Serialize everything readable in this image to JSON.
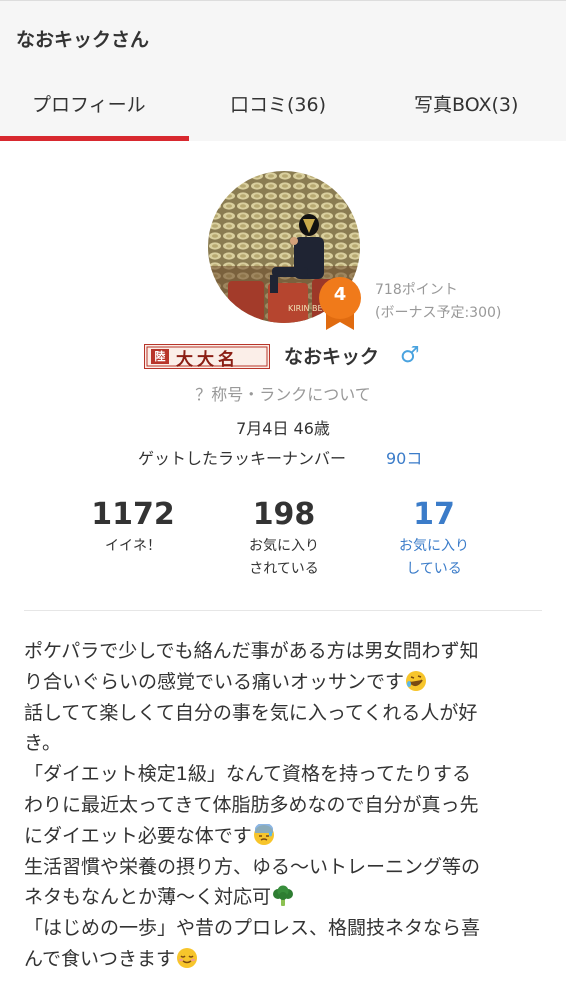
{
  "header": {
    "title": "なおキックさん"
  },
  "tabs": [
    {
      "label": "プロフィール",
      "active": true
    },
    {
      "label": "口コミ(36)",
      "active": false
    },
    {
      "label": "写真BOX(3)",
      "active": false
    }
  ],
  "profile": {
    "rank": "4",
    "points": "718ポイント",
    "bonus": "(ボーナス予定:300)",
    "title_badge": "大大名",
    "username": "なおキック",
    "gender_symbol": "♂",
    "rank_link": "？称号・ランクについて",
    "birthday_age": "7月4日 46歳",
    "lucky_label": "ゲットしたラッキーナンバー",
    "lucky_value": "90コ",
    "title_badge_emblem": "陸"
  },
  "stats": [
    {
      "value": "1172",
      "label_1": "イイネ！",
      "label_2": ""
    },
    {
      "value": "198",
      "label_1": "お気に入り",
      "label_2": "されている"
    },
    {
      "value": "17",
      "label_1": "お気に入り",
      "label_2": "している"
    }
  ],
  "bio": {
    "line1": "ポケパラで少しでも絡んだ事がある方は男女問わず知",
    "line2": "り合いぐらいの感覚でいる痛いオッサンです",
    "line3": "話してて楽しくて自分の事を気に入ってくれる人が好",
    "line4": "き。",
    "line5": "「ダイエット検定1級」なんて資格を持ってたりする",
    "line6": "わりに最近太ってきて体脂肪多めなので自分が真っ先",
    "line7": "にダイエット必要な体です",
    "line8": "生活習慣や栄養の摂り方、ゆる〜いトレーニング等の",
    "line9": "ネタもなんとか薄〜く対応可",
    "line10": "「はじめの一歩」や昔のプロレス、格闘技ネタなら喜",
    "line11": "んで食いつきます"
  },
  "colors": {
    "accent": "#d8292f",
    "link": "#3b7cc9",
    "badge": "#f07a1a",
    "gender": "#4aa3df"
  },
  "icons": [
    "rolling-laugh-emoji",
    "sweat-face-emoji",
    "broccoli-emoji",
    "relieved-face-emoji"
  ]
}
